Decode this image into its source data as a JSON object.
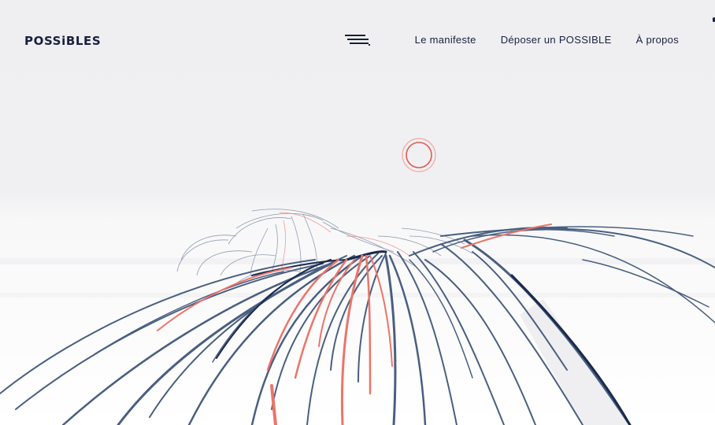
{
  "brand": {
    "logo_text": "POSSiBLES"
  },
  "nav": {
    "items": [
      {
        "label": "Le manifeste"
      },
      {
        "label": "Déposer un POSSIBLE"
      },
      {
        "label": "À propos"
      }
    ]
  },
  "colors": {
    "navy": "#1a1f3d",
    "line_blue": "#4a5f80",
    "line_red": "#ec7468",
    "background": "#f3f3f5"
  },
  "icons": {
    "menu": "hamburger-icon",
    "target": "circle-target-icon"
  }
}
